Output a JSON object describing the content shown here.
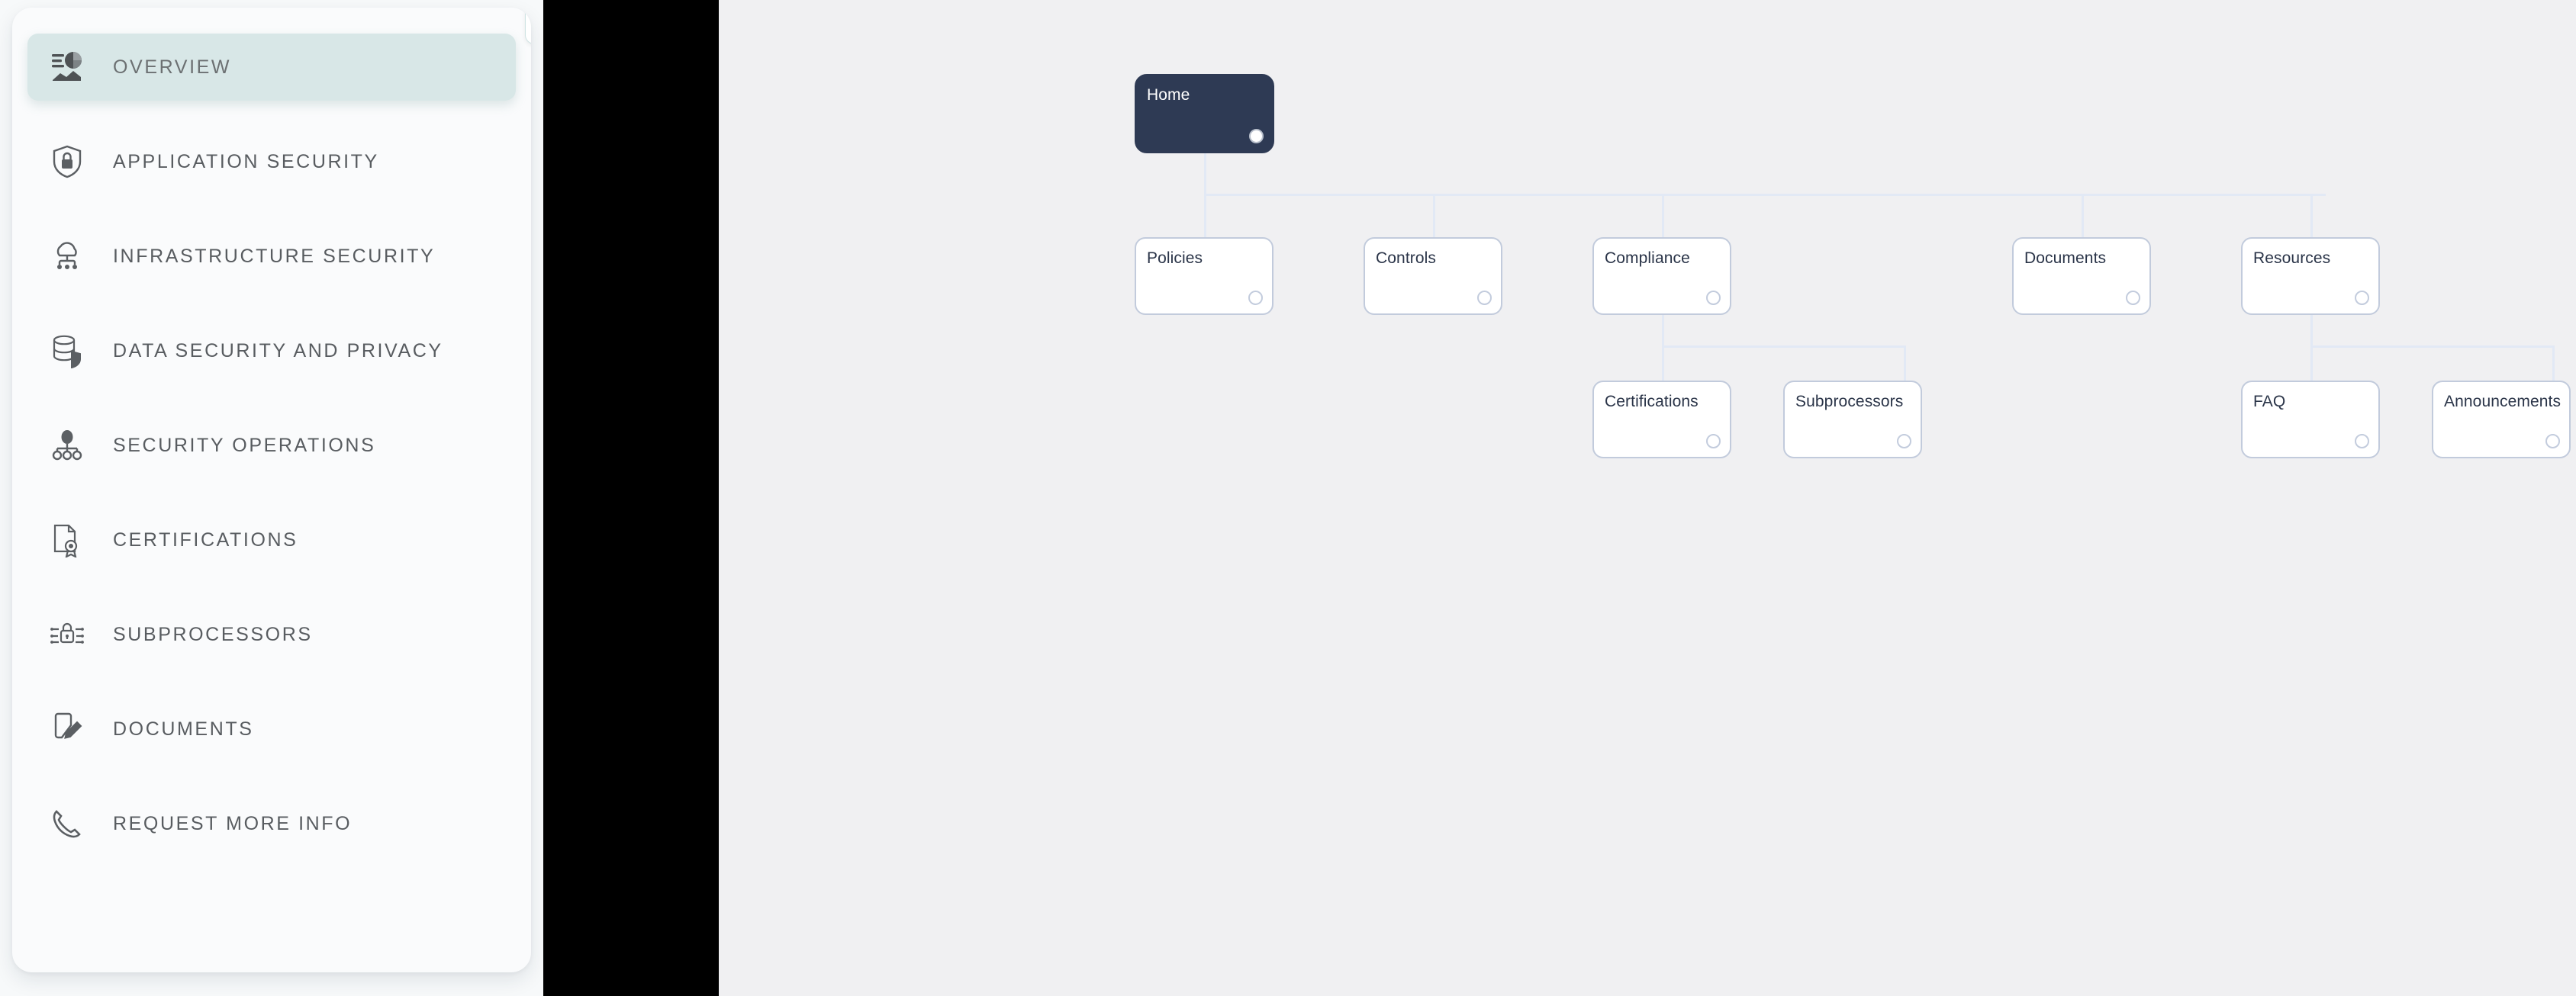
{
  "sidebar": {
    "minimize_button_label": "—",
    "items": [
      {
        "label": "OVERVIEW",
        "icon": "overview-chart-icon",
        "active": true
      },
      {
        "label": "APPLICATION SECURITY",
        "icon": "shield-lock-icon",
        "active": false
      },
      {
        "label": "INFRASTRUCTURE SECURITY",
        "icon": "cloud-network-icon",
        "active": false
      },
      {
        "label": "DATA SECURITY AND PRIVACY",
        "icon": "database-shield-icon",
        "active": false
      },
      {
        "label": "SECURITY OPERATIONS",
        "icon": "org-node-icon",
        "active": false
      },
      {
        "label": "CERTIFICATIONS",
        "icon": "certificate-icon",
        "active": false
      },
      {
        "label": "SUBPROCESSORS",
        "icon": "lock-circuit-icon",
        "active": false
      },
      {
        "label": "DOCUMENTS",
        "icon": "document-edit-icon",
        "active": false
      },
      {
        "label": "REQUEST MORE INFO",
        "icon": "phone-icon",
        "active": false
      }
    ]
  },
  "diagram": {
    "nodes": {
      "home": "Home",
      "policies": "Policies",
      "controls": "Controls",
      "compliance": "Compliance",
      "documents": "Documents",
      "resources": "Resources",
      "certifications": "Certifications",
      "subprocessors": "Subprocessors",
      "faq": "FAQ",
      "announcements": "Announcements"
    },
    "edges": [
      {
        "from": "home",
        "to": "policies"
      },
      {
        "from": "home",
        "to": "controls"
      },
      {
        "from": "home",
        "to": "compliance"
      },
      {
        "from": "home",
        "to": "documents"
      },
      {
        "from": "home",
        "to": "resources"
      },
      {
        "from": "compliance",
        "to": "certifications"
      },
      {
        "from": "compliance",
        "to": "subprocessors"
      },
      {
        "from": "resources",
        "to": "faq"
      },
      {
        "from": "resources",
        "to": "announcements"
      }
    ]
  },
  "colors": {
    "canvas_background": "#f0f0f2",
    "sidebar_background": "#fafbfc",
    "active_item_background": "#d8e7e7",
    "root_node_background": "#2e3a54",
    "node_border": "#c2cbdc",
    "edge_color": "#e2e9f5",
    "band_color": "#000000"
  }
}
